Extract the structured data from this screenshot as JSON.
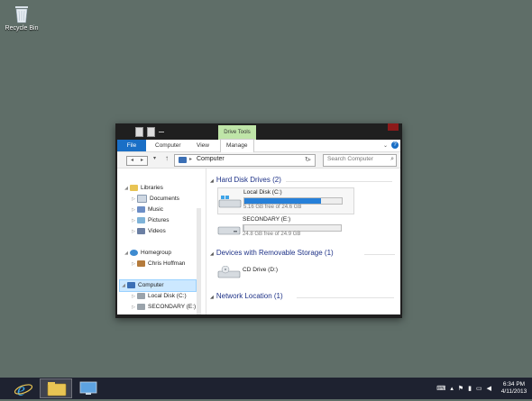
{
  "desktop": {
    "recycle_bin_label": "Recycle Bin"
  },
  "window": {
    "contextual_tab": "Drive Tools",
    "tabs": [
      "File",
      "Computer",
      "View",
      "Manage"
    ],
    "help_icon": "?",
    "address": {
      "path": "Computer",
      "search_placeholder": "Search Computer"
    },
    "nav": {
      "libraries": "Libraries",
      "documents": "Documents",
      "music": "Music",
      "pictures": "Pictures",
      "videos": "Videos",
      "homegroup": "Homegroup",
      "user": "Chris Hoffman",
      "computer": "Computer",
      "local_disk": "Local Disk (C:)",
      "secondary": "SECONDARY (E:)"
    },
    "groups": {
      "hdd": "Hard Disk Drives (2)",
      "removable": "Devices with Removable Storage (1)",
      "network": "Network Location (1)"
    },
    "drives": [
      {
        "name": "Local Disk (C:)",
        "free": "5.16 GB free of 24.6 GB",
        "used_fraction": 0.79
      },
      {
        "name": "SECONDARY (E:)",
        "free": "24.8 GB free of 24.9 GB",
        "used_fraction": 0.004
      }
    ],
    "cd_drive": "CD Drive (D:)"
  },
  "taskbar": {
    "time": "6:34 PM",
    "date": "4/11/2013",
    "accent": "#1e2230"
  }
}
